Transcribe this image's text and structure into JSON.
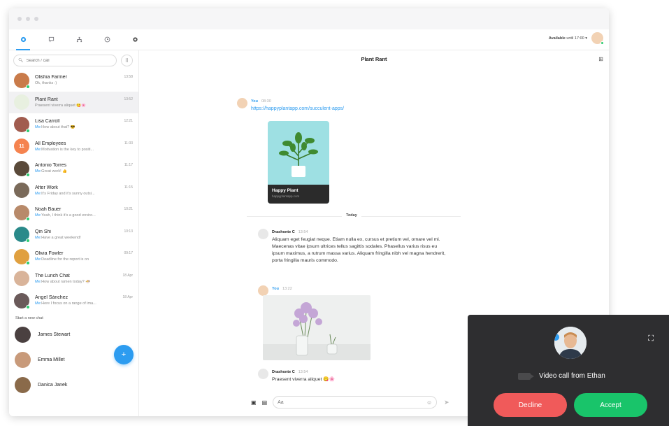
{
  "status": {
    "label": "Available",
    "until": "until 17:00"
  },
  "search": {
    "placeholder": "Search / call"
  },
  "chats": [
    {
      "name": "Olishia Farmer",
      "me": "",
      "preview": "Ok, thanks :)",
      "time": "13:58",
      "color": "#c97b4a",
      "online": true
    },
    {
      "name": "Plant Rant",
      "me": "",
      "preview": "Praesent viverra aliquet 😋🌸",
      "time": "13:52",
      "color": "#e8f0e0",
      "online": false,
      "selected": true
    },
    {
      "name": "Lisa Carroll",
      "me": "Me:",
      "preview": "How about that? 😎",
      "time": "12:21",
      "color": "#a15c4f",
      "online": true
    },
    {
      "name": "All Employees",
      "me": "Me:",
      "preview": "Motivation is the key to positi...",
      "time": "11:33",
      "color": "#f5834f",
      "online": false,
      "initials": "11"
    },
    {
      "name": "Antonio Torres",
      "me": "Me:",
      "preview": "Great work! 👍",
      "time": "11:17",
      "color": "#5a4a3a",
      "online": true
    },
    {
      "name": "After Work",
      "me": "Me:",
      "preview": "It's Friday and it's sunny outsi...",
      "time": "11:15",
      "color": "#7a6a5a",
      "online": false
    },
    {
      "name": "Noah Bauer",
      "me": "Me:",
      "preview": "Yeah, I think it's a good enviro...",
      "time": "10:21",
      "color": "#b88a6a",
      "online": true
    },
    {
      "name": "Qin Shi",
      "me": "Me:",
      "preview": "Have a great weekend!",
      "time": "10:13",
      "color": "#2a8a8a",
      "online": true
    },
    {
      "name": "Olivia Fowler",
      "me": "Me:",
      "preview": "Deadline for the report is on",
      "time": "09:17",
      "color": "#e0a040",
      "online": true
    },
    {
      "name": "The Lunch Chat",
      "me": "Me:",
      "preview": "How about ramen today? 🍜",
      "time": "18 Apr",
      "color": "#d9b49a",
      "online": false
    },
    {
      "name": "Ángel Sánchez",
      "me": "Me:",
      "preview": "Here I focus on a range of ima...",
      "time": "18 Apr",
      "color": "#6a5a5a",
      "online": true
    }
  ],
  "new_chat_label": "Start a new chat",
  "contacts": [
    {
      "name": "James Stewart",
      "color": "#4a4040"
    },
    {
      "name": "Emma Millet",
      "color": "#c89a7a"
    },
    {
      "name": "Danica Janek",
      "color": "#8a6a4a"
    }
  ],
  "conversation": {
    "title": "Plant Rant",
    "msg1": {
      "who": "You",
      "time": "08:30",
      "link": "https://happyplantapp.com/succulent-apps/"
    },
    "card": {
      "title": "Happy Plant",
      "url": "happyplantapp.com"
    },
    "divider": "Today",
    "msg2": {
      "who": "Drashonte C",
      "time": "13:54",
      "text": "Aliquam eget feugiat neque. Etiam nulla ex, cursus et pretium vel, ornare vel mi. Maecenas vitae ipsum ultrices tellus sagittis sodales. Phasellus varius risus eu ipsum maximus, a rutrum massa varius. Aliquam fringilla nibh vel magna hendrerit, porta fringilla mauris commodo."
    },
    "msg3": {
      "who": "You",
      "time": "13:22"
    },
    "msg4": {
      "who": "Drashonte C",
      "time": "13:54",
      "text": "Praesent viverra aliquet 😋🌸"
    }
  },
  "composer": {
    "placeholder": "Aa"
  },
  "call": {
    "text": "Video call from Ethan",
    "decline": "Decline",
    "accept": "Accept"
  }
}
